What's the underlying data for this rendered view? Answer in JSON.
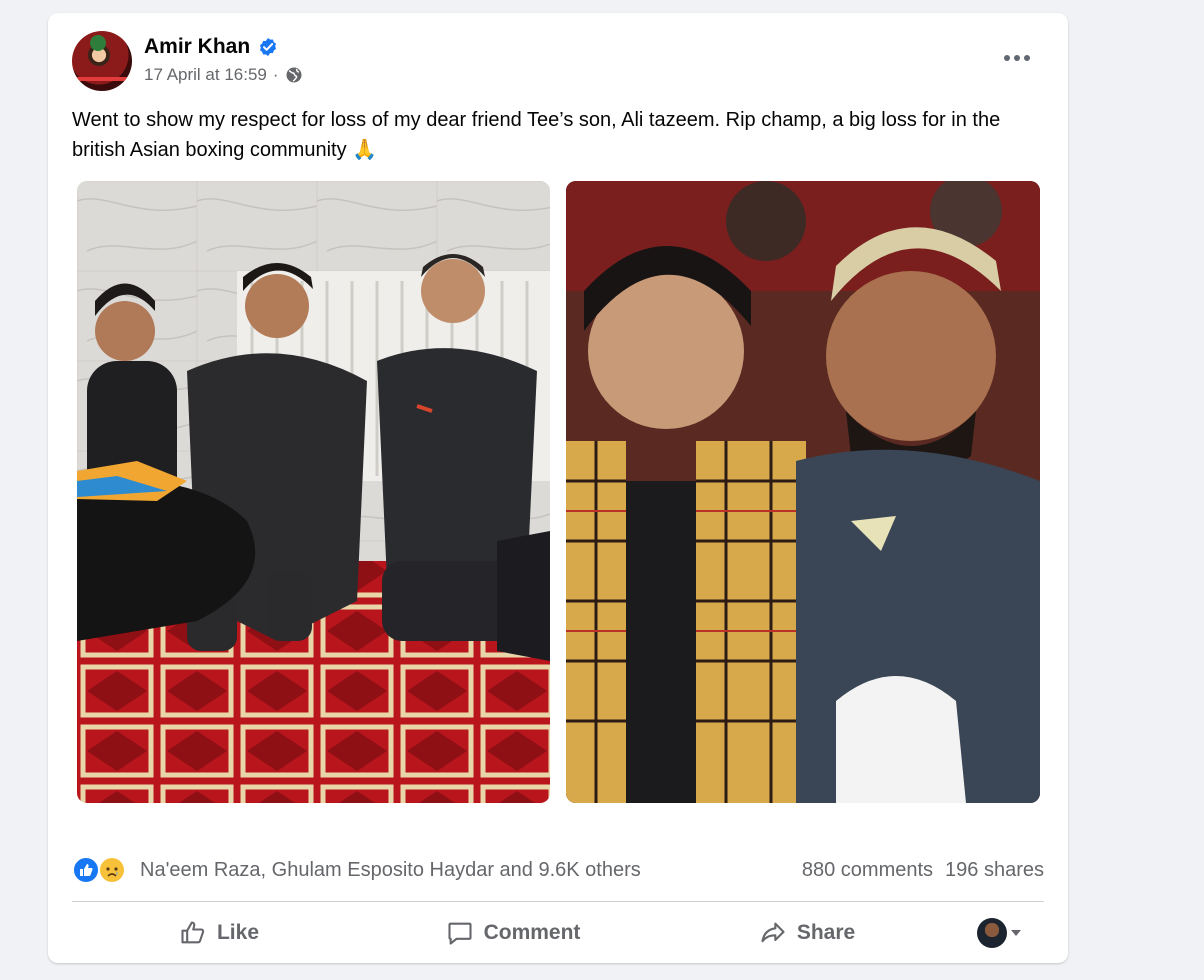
{
  "post": {
    "author": "Amir Khan",
    "timestamp": "17 April at 16:59",
    "separator": "·",
    "audience_icon": "globe-icon",
    "verified_icon": "verified-badge-icon",
    "menu_icon": "more-options-icon",
    "text": "Went to show my respect for loss of my dear friend Tee’s son, Ali tazeem. Rip champ, a big loss for in the british Asian boxing community 🙏"
  },
  "photos": [
    {
      "description_icon": "photo-left"
    },
    {
      "description_icon": "photo-right"
    }
  ],
  "stats": {
    "reaction_icons": [
      "like-reaction-icon",
      "sad-reaction-icon"
    ],
    "reactors": "Na'eem Raza, Ghulam Esposito Haydar and 9.6K others",
    "comments": "880 comments",
    "shares": "196 shares"
  },
  "actions": {
    "like_label": "Like",
    "comment_label": "Comment",
    "share_label": "Share"
  },
  "colors": {
    "brand_blue": "#1877f2",
    "secondary_text": "#65676b",
    "page_bg": "#f0f2f5"
  }
}
